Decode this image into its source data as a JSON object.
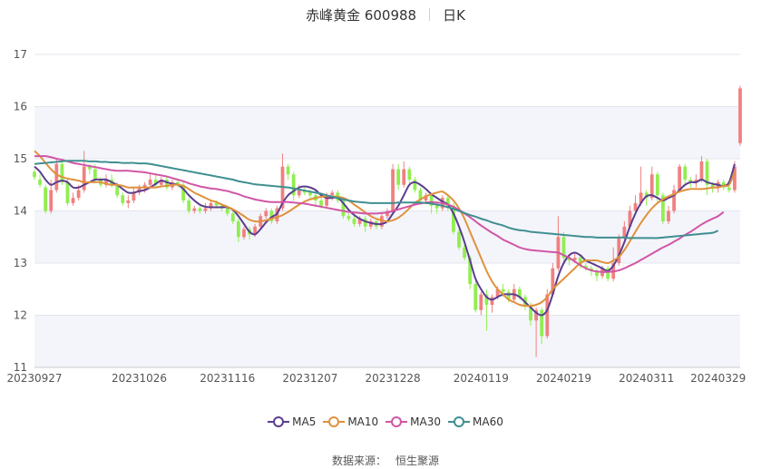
{
  "header": {
    "title": "赤峰黄金 600988",
    "period": "日K"
  },
  "source": {
    "label": "数据来源：",
    "name": "恒生聚源"
  },
  "chart_data": {
    "type": "candlestick",
    "ylim": [
      11,
      17
    ],
    "y_ticks": [
      11,
      12,
      13,
      14,
      15,
      16,
      17
    ],
    "x_tick_labels": [
      {
        "date": "20230927",
        "index": 0
      },
      {
        "date": "20231026",
        "index": 19
      },
      {
        "date": "20231116",
        "index": 35
      },
      {
        "date": "20231207",
        "index": 50
      },
      {
        "date": "20231228",
        "index": 65
      },
      {
        "date": "20240119",
        "index": 81
      },
      {
        "date": "20240219",
        "index": 96
      },
      {
        "date": "20240311",
        "index": 111
      },
      {
        "date": "20240329",
        "index": 124
      }
    ],
    "colors": {
      "up": "#f08080",
      "down": "#90ee50"
    },
    "legend_position": "bottom-center",
    "candles": [
      [
        14.75,
        14.65,
        14.8,
        14.6
      ],
      [
        14.6,
        14.5,
        14.7,
        14.45
      ],
      [
        14.45,
        14.0,
        14.5,
        13.95
      ],
      [
        14.0,
        14.4,
        14.6,
        13.95
      ],
      [
        14.4,
        14.9,
        15.0,
        14.35
      ],
      [
        14.9,
        14.55,
        14.95,
        14.5
      ],
      [
        14.55,
        14.15,
        14.6,
        14.1
      ],
      [
        14.15,
        14.25,
        14.35,
        14.1
      ],
      [
        14.25,
        14.4,
        14.5,
        14.2
      ],
      [
        14.4,
        14.85,
        15.15,
        14.35
      ],
      [
        14.85,
        14.8,
        14.9,
        14.7
      ],
      [
        14.8,
        14.6,
        14.9,
        14.55
      ],
      [
        14.6,
        14.5,
        14.65,
        14.45
      ],
      [
        14.5,
        14.6,
        14.7,
        14.45
      ],
      [
        14.6,
        14.5,
        14.7,
        14.45
      ],
      [
        14.5,
        14.3,
        14.55,
        14.25
      ],
      [
        14.3,
        14.15,
        14.35,
        14.1
      ],
      [
        14.15,
        14.2,
        14.3,
        14.05
      ],
      [
        14.2,
        14.35,
        14.45,
        14.15
      ],
      [
        14.35,
        14.45,
        14.5,
        14.3
      ],
      [
        14.45,
        14.5,
        14.55,
        14.35
      ],
      [
        14.5,
        14.6,
        14.7,
        14.45
      ],
      [
        14.6,
        14.5,
        14.7,
        14.45
      ],
      [
        14.5,
        14.6,
        14.65,
        14.45
      ],
      [
        14.6,
        14.45,
        14.65,
        14.4
      ],
      [
        14.45,
        14.55,
        14.6,
        14.4
      ],
      [
        14.55,
        14.5,
        14.6,
        14.45
      ],
      [
        14.5,
        14.2,
        14.55,
        14.15
      ],
      [
        14.2,
        14.0,
        14.25,
        13.95
      ],
      [
        14.0,
        14.05,
        14.1,
        13.95
      ],
      [
        14.05,
        14.0,
        14.1,
        13.95
      ],
      [
        14.0,
        14.05,
        14.15,
        13.95
      ],
      [
        14.05,
        14.15,
        14.2,
        14.0
      ],
      [
        14.15,
        14.1,
        14.2,
        14.05
      ],
      [
        14.1,
        14.05,
        14.15,
        14.0
      ],
      [
        14.05,
        13.95,
        14.1,
        13.9
      ],
      [
        13.95,
        13.8,
        14.0,
        13.75
      ],
      [
        13.8,
        13.5,
        13.85,
        13.4
      ],
      [
        13.5,
        13.65,
        13.7,
        13.45
      ],
      [
        13.65,
        13.55,
        13.7,
        13.45
      ],
      [
        13.55,
        13.7,
        13.75,
        13.5
      ],
      [
        13.7,
        13.9,
        13.95,
        13.65
      ],
      [
        13.9,
        14.0,
        14.05,
        13.85
      ],
      [
        14.0,
        13.8,
        14.05,
        13.75
      ],
      [
        13.8,
        14.05,
        14.1,
        13.75
      ],
      [
        14.05,
        14.85,
        15.1,
        14.0
      ],
      [
        14.85,
        14.7,
        14.9,
        14.6
      ],
      [
        14.7,
        14.3,
        14.75,
        14.2
      ],
      [
        14.3,
        14.4,
        14.5,
        14.25
      ],
      [
        14.4,
        14.35,
        14.45,
        14.3
      ],
      [
        14.35,
        14.3,
        14.4,
        14.2
      ],
      [
        14.3,
        14.2,
        14.35,
        14.1
      ],
      [
        14.2,
        14.1,
        14.25,
        14.05
      ],
      [
        14.1,
        14.3,
        14.35,
        14.05
      ],
      [
        14.3,
        14.35,
        14.4,
        14.2
      ],
      [
        14.35,
        14.2,
        14.4,
        14.15
      ],
      [
        14.2,
        13.9,
        14.25,
        13.85
      ],
      [
        13.9,
        13.85,
        13.95,
        13.8
      ],
      [
        13.85,
        13.75,
        13.9,
        13.7
      ],
      [
        13.75,
        13.85,
        13.9,
        13.7
      ],
      [
        13.85,
        13.7,
        13.9,
        13.6
      ],
      [
        13.7,
        13.8,
        13.85,
        13.65
      ],
      [
        13.8,
        13.7,
        13.85,
        13.65
      ],
      [
        13.7,
        13.9,
        13.95,
        13.65
      ],
      [
        13.9,
        14.0,
        14.05,
        13.85
      ],
      [
        14.0,
        14.8,
        14.9,
        13.95
      ],
      [
        14.8,
        14.5,
        14.9,
        14.4
      ],
      [
        14.5,
        14.8,
        14.95,
        14.45
      ],
      [
        14.8,
        14.6,
        14.85,
        14.5
      ],
      [
        14.6,
        14.4,
        14.65,
        14.35
      ],
      [
        14.4,
        14.2,
        14.45,
        14.15
      ],
      [
        14.2,
        14.3,
        14.35,
        14.15
      ],
      [
        14.3,
        14.1,
        14.35,
        13.95
      ],
      [
        14.1,
        14.05,
        14.15,
        13.95
      ],
      [
        14.05,
        14.25,
        14.3,
        14.0
      ],
      [
        14.25,
        14.1,
        14.3,
        14.0
      ],
      [
        14.1,
        13.6,
        14.15,
        13.55
      ],
      [
        13.6,
        13.3,
        13.65,
        13.25
      ],
      [
        13.3,
        13.1,
        13.35,
        13.05
      ],
      [
        13.1,
        12.6,
        13.15,
        12.5
      ],
      [
        12.6,
        12.1,
        12.65,
        12.05
      ],
      [
        12.1,
        12.4,
        12.45,
        12.0
      ],
      [
        12.4,
        12.2,
        12.5,
        11.7
      ],
      [
        12.2,
        12.35,
        12.4,
        12.05
      ],
      [
        12.35,
        12.5,
        12.55,
        12.3
      ],
      [
        12.5,
        12.45,
        12.6,
        12.35
      ],
      [
        12.45,
        12.3,
        12.5,
        12.25
      ],
      [
        12.3,
        12.5,
        12.6,
        12.25
      ],
      [
        12.5,
        12.35,
        12.55,
        12.3
      ],
      [
        12.35,
        12.2,
        12.4,
        12.1
      ],
      [
        12.2,
        11.9,
        12.25,
        11.8
      ],
      [
        11.9,
        12.1,
        12.15,
        11.2
      ],
      [
        12.1,
        11.6,
        12.15,
        11.45
      ],
      [
        11.6,
        12.4,
        12.5,
        11.55
      ],
      [
        12.4,
        12.9,
        13.0,
        12.35
      ],
      [
        12.9,
        13.5,
        13.9,
        12.85
      ],
      [
        13.5,
        13.1,
        13.6,
        13.0
      ],
      [
        13.1,
        13.05,
        13.15,
        12.95
      ],
      [
        13.05,
        13.1,
        13.2,
        13.0
      ],
      [
        13.1,
        12.95,
        13.15,
        12.9
      ],
      [
        12.95,
        12.9,
        13.0,
        12.85
      ],
      [
        12.9,
        12.85,
        12.95,
        12.75
      ],
      [
        12.85,
        12.75,
        12.9,
        12.65
      ],
      [
        12.75,
        12.9,
        12.95,
        12.7
      ],
      [
        12.9,
        12.7,
        12.95,
        12.65
      ],
      [
        12.7,
        13.0,
        13.3,
        12.65
      ],
      [
        13.0,
        13.5,
        13.55,
        12.95
      ],
      [
        13.5,
        13.7,
        13.8,
        13.45
      ],
      [
        13.7,
        14.0,
        14.1,
        13.65
      ],
      [
        14.0,
        14.15,
        14.3,
        13.95
      ],
      [
        14.15,
        14.35,
        14.85,
        14.1
      ],
      [
        14.35,
        14.25,
        14.4,
        14.1
      ],
      [
        14.25,
        14.7,
        14.85,
        14.2
      ],
      [
        14.7,
        14.3,
        14.75,
        14.15
      ],
      [
        14.3,
        13.8,
        14.35,
        13.75
      ],
      [
        13.8,
        14.0,
        14.1,
        13.75
      ],
      [
        14.0,
        14.4,
        14.5,
        13.95
      ],
      [
        14.4,
        14.85,
        14.9,
        14.35
      ],
      [
        14.85,
        14.6,
        14.9,
        14.5
      ],
      [
        14.6,
        14.55,
        14.65,
        14.45
      ],
      [
        14.55,
        14.6,
        14.7,
        14.45
      ],
      [
        14.6,
        14.95,
        15.05,
        14.55
      ],
      [
        14.95,
        14.5,
        15.0,
        14.3
      ],
      [
        14.5,
        14.45,
        14.55,
        14.35
      ],
      [
        14.45,
        14.55,
        14.6,
        14.35
      ],
      [
        14.55,
        14.45,
        14.6,
        14.4
      ],
      [
        14.45,
        14.4,
        14.5,
        14.35
      ],
      [
        14.4,
        14.85,
        14.95,
        14.35
      ],
      [
        15.3,
        16.35,
        16.4,
        15.25
      ]
    ],
    "series": [
      {
        "name": "MA5",
        "color": "#5b3d8f",
        "values": [
          14.85,
          14.75,
          14.6,
          14.5,
          14.55,
          14.58,
          14.55,
          14.45,
          14.45,
          14.5,
          14.55,
          14.6,
          14.6,
          14.6,
          14.55,
          14.5,
          14.42,
          14.35,
          14.35,
          14.38,
          14.4,
          14.45,
          14.52,
          14.58,
          14.55,
          14.52,
          14.5,
          14.42,
          14.3,
          14.2,
          14.12,
          14.08,
          14.07,
          14.07,
          14.07,
          14.07,
          14.02,
          13.9,
          13.75,
          13.6,
          13.55,
          13.65,
          13.78,
          13.88,
          13.95,
          14.15,
          14.3,
          14.38,
          14.45,
          14.47,
          14.45,
          14.4,
          14.3,
          14.25,
          14.25,
          14.25,
          14.15,
          14.02,
          13.92,
          13.85,
          13.8,
          13.77,
          13.75,
          13.75,
          13.8,
          13.95,
          14.1,
          14.3,
          14.5,
          14.55,
          14.5,
          14.42,
          14.32,
          14.25,
          14.18,
          14.12,
          13.95,
          13.7,
          13.4,
          13.05,
          12.7,
          12.5,
          12.35,
          12.3,
          12.35,
          12.4,
          12.4,
          12.4,
          12.35,
          12.25,
          12.15,
          12.05,
          12.0,
          12.1,
          12.4,
          12.75,
          13.0,
          13.15,
          13.2,
          13.15,
          13.05,
          13.0,
          12.95,
          12.9,
          12.85,
          12.95,
          13.15,
          13.4,
          13.7,
          13.95,
          14.15,
          14.28,
          14.3,
          14.25,
          14.2,
          14.25,
          14.3,
          14.4,
          14.5,
          14.55,
          14.55,
          14.6,
          14.55,
          14.52,
          14.5,
          14.48,
          14.55,
          14.9
        ]
      },
      {
        "name": "MA10",
        "color": "#e0913e",
        "values": [
          15.15,
          15.05,
          14.92,
          14.8,
          14.7,
          14.65,
          14.62,
          14.6,
          14.58,
          14.55,
          14.55,
          14.55,
          14.55,
          14.52,
          14.5,
          14.5,
          14.48,
          14.45,
          14.45,
          14.45,
          14.45,
          14.45,
          14.45,
          14.47,
          14.48,
          14.5,
          14.5,
          14.48,
          14.42,
          14.35,
          14.3,
          14.25,
          14.2,
          14.17,
          14.12,
          14.08,
          14.03,
          13.97,
          13.9,
          13.83,
          13.8,
          13.8,
          13.82,
          13.85,
          13.88,
          13.92,
          13.98,
          14.05,
          14.12,
          14.18,
          14.22,
          14.25,
          14.27,
          14.28,
          14.28,
          14.27,
          14.25,
          14.2,
          14.12,
          14.05,
          13.97,
          13.9,
          13.85,
          13.82,
          13.8,
          13.82,
          13.87,
          13.95,
          14.05,
          14.15,
          14.22,
          14.28,
          14.32,
          14.35,
          14.37,
          14.3,
          14.2,
          14.05,
          13.85,
          13.6,
          13.35,
          13.1,
          12.85,
          12.65,
          12.5,
          12.4,
          12.3,
          12.25,
          12.2,
          12.18,
          12.18,
          12.2,
          12.25,
          12.35,
          12.5,
          12.6,
          12.7,
          12.8,
          12.9,
          13.0,
          13.05,
          13.05,
          13.05,
          13.02,
          13.0,
          13.05,
          13.12,
          13.25,
          13.42,
          13.6,
          13.77,
          13.92,
          14.05,
          14.15,
          14.22,
          14.28,
          14.32,
          14.37,
          14.4,
          14.42,
          14.42,
          14.42,
          14.43,
          14.45,
          14.45,
          14.48,
          14.5,
          14.75
        ]
      },
      {
        "name": "MA30",
        "color": "#d156a6",
        "values": [
          15.05,
          15.05,
          15.05,
          15.03,
          15.0,
          14.98,
          14.95,
          14.92,
          14.9,
          14.88,
          14.86,
          14.84,
          14.82,
          14.8,
          14.78,
          14.77,
          14.77,
          14.77,
          14.76,
          14.75,
          14.74,
          14.72,
          14.7,
          14.68,
          14.66,
          14.63,
          14.6,
          14.57,
          14.53,
          14.5,
          14.47,
          14.45,
          14.43,
          14.42,
          14.4,
          14.38,
          14.35,
          14.32,
          14.28,
          14.25,
          14.22,
          14.2,
          14.18,
          14.17,
          14.17,
          14.17,
          14.17,
          14.16,
          14.15,
          14.14,
          14.12,
          14.1,
          14.08,
          14.06,
          14.04,
          14.02,
          14.0,
          13.98,
          13.97,
          13.96,
          13.95,
          13.95,
          13.95,
          13.96,
          13.97,
          14.0,
          14.03,
          14.06,
          14.09,
          14.12,
          14.14,
          14.16,
          14.17,
          14.16,
          14.15,
          14.12,
          14.08,
          14.02,
          13.95,
          13.88,
          13.8,
          13.72,
          13.65,
          13.58,
          13.52,
          13.45,
          13.4,
          13.35,
          13.3,
          13.27,
          13.25,
          13.24,
          13.23,
          13.22,
          13.21,
          13.2,
          13.15,
          13.1,
          13.03,
          12.96,
          12.9,
          12.86,
          12.84,
          12.83,
          12.83,
          12.84,
          12.86,
          12.9,
          12.95,
          13.0,
          13.06,
          13.12,
          13.18,
          13.24,
          13.3,
          13.35,
          13.41,
          13.47,
          13.54,
          13.6,
          13.67,
          13.74,
          13.8,
          13.85,
          13.9,
          13.98
        ]
      },
      {
        "name": "MA60",
        "color": "#3f8f91",
        "values": [
          14.9,
          14.91,
          14.92,
          14.93,
          14.94,
          14.95,
          14.96,
          14.96,
          14.96,
          14.96,
          14.95,
          14.95,
          14.94,
          14.94,
          14.93,
          14.93,
          14.92,
          14.92,
          14.92,
          14.91,
          14.91,
          14.9,
          14.88,
          14.86,
          14.84,
          14.82,
          14.8,
          14.78,
          14.76,
          14.74,
          14.72,
          14.7,
          14.68,
          14.66,
          14.64,
          14.62,
          14.6,
          14.57,
          14.55,
          14.53,
          14.51,
          14.5,
          14.49,
          14.48,
          14.47,
          14.46,
          14.45,
          14.43,
          14.41,
          14.39,
          14.37,
          14.35,
          14.33,
          14.3,
          14.27,
          14.25,
          14.22,
          14.2,
          14.18,
          14.17,
          14.16,
          14.15,
          14.15,
          14.15,
          14.15,
          14.15,
          14.16,
          14.16,
          14.16,
          14.16,
          14.16,
          14.15,
          14.14,
          14.12,
          14.1,
          14.07,
          14.04,
          14.0,
          13.96,
          13.92,
          13.89,
          13.85,
          13.82,
          13.78,
          13.75,
          13.72,
          13.68,
          13.65,
          13.63,
          13.62,
          13.6,
          13.59,
          13.58,
          13.57,
          13.56,
          13.55,
          13.54,
          13.53,
          13.52,
          13.51,
          13.5,
          13.5,
          13.49,
          13.49,
          13.49,
          13.49,
          13.49,
          13.49,
          13.48,
          13.48,
          13.48,
          13.48,
          13.48,
          13.48,
          13.49,
          13.5,
          13.51,
          13.52,
          13.53,
          13.54,
          13.55,
          13.56,
          13.57,
          13.58,
          13.62
        ]
      }
    ]
  }
}
